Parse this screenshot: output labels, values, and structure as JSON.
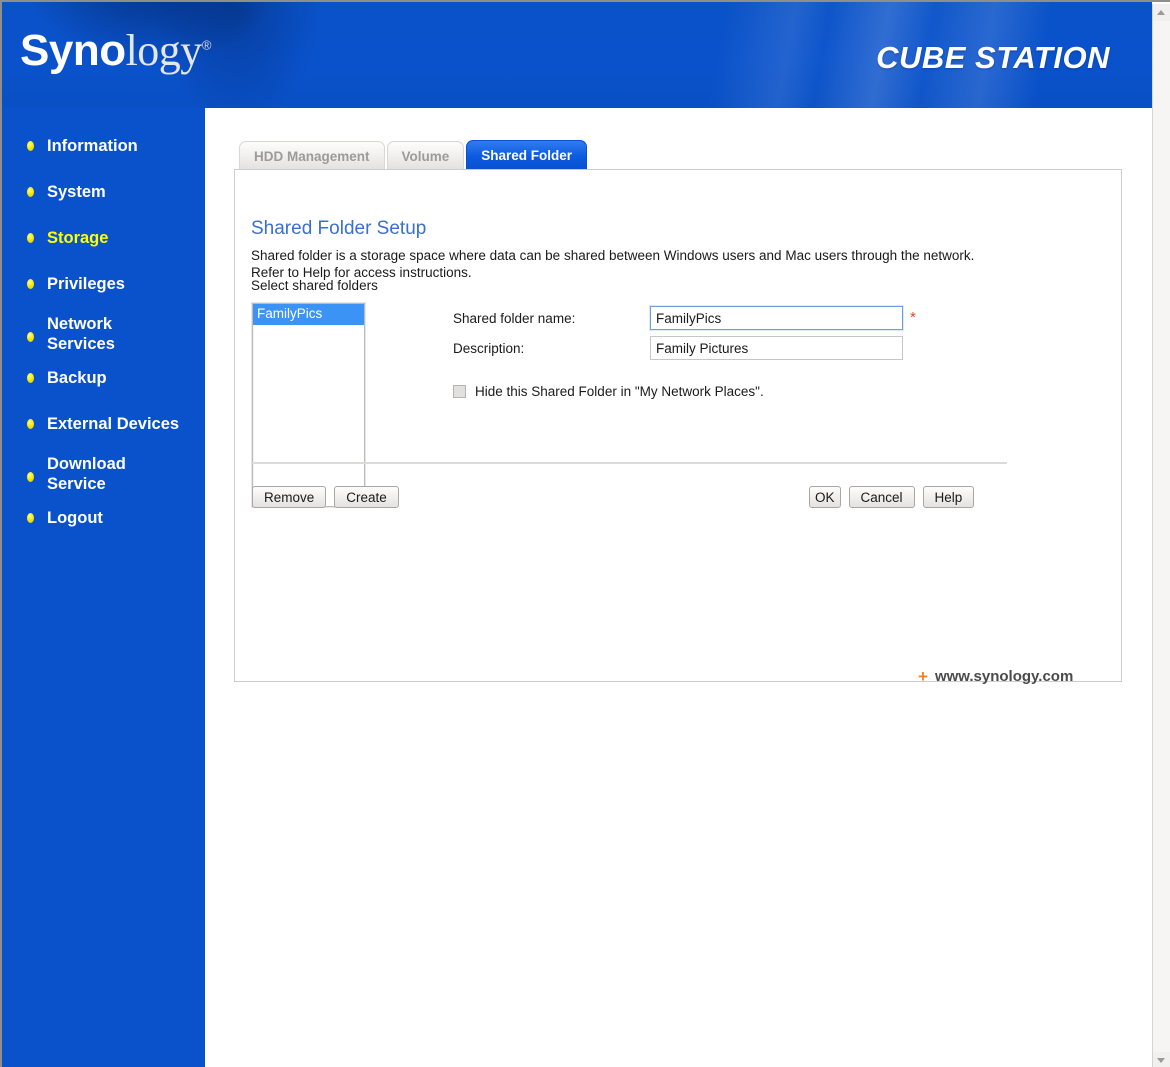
{
  "header": {
    "logo_bold": "Syno",
    "logo_light": "logy",
    "logo_registered": "®",
    "product_title": "CUBE STATION"
  },
  "sidebar": {
    "items": [
      {
        "label": "Information",
        "active": false
      },
      {
        "label": "System",
        "active": false
      },
      {
        "label": "Storage",
        "active": true
      },
      {
        "label": "Privileges",
        "active": false
      },
      {
        "label": "Network\nServices",
        "active": false
      },
      {
        "label": "Backup",
        "active": false
      },
      {
        "label": "External Devices",
        "active": false
      },
      {
        "label": "Download\nService",
        "active": false
      },
      {
        "label": "Logout",
        "active": false
      }
    ]
  },
  "tabs": [
    {
      "label": "HDD Management",
      "active": false
    },
    {
      "label": "Volume",
      "active": false
    },
    {
      "label": "Shared Folder",
      "active": true
    }
  ],
  "panel": {
    "section_title": "Shared Folder Setup",
    "section_description": "Shared folder is a storage space where data can be shared between Windows users and Mac users through the network. Refer to Help for access instructions.",
    "select_label": "Select shared folders",
    "folder_list": [
      {
        "name": "FamilyPics",
        "selected": true
      }
    ],
    "form": {
      "name_label": "Shared folder name:",
      "name_value": "FamilyPics",
      "name_required_mark": "*",
      "description_label": "Description:",
      "description_value": "Family Pictures",
      "hide_checkbox_label": "Hide this Shared Folder in \"My Network Places\".",
      "hide_checkbox_checked": false
    },
    "buttons": {
      "remove": "Remove",
      "create": "Create",
      "ok": "OK",
      "cancel": "Cancel",
      "help": "Help"
    }
  },
  "footer": {
    "plus": "+",
    "link_text": "www.synology.com"
  },
  "colors": {
    "brand_blue": "#0a52cc",
    "accent_yellow": "#ffff00",
    "title_blue": "#3a6fd0",
    "required_red": "#e8452c",
    "footer_orange": "#f28420",
    "selection_blue": "#3a93f5"
  }
}
